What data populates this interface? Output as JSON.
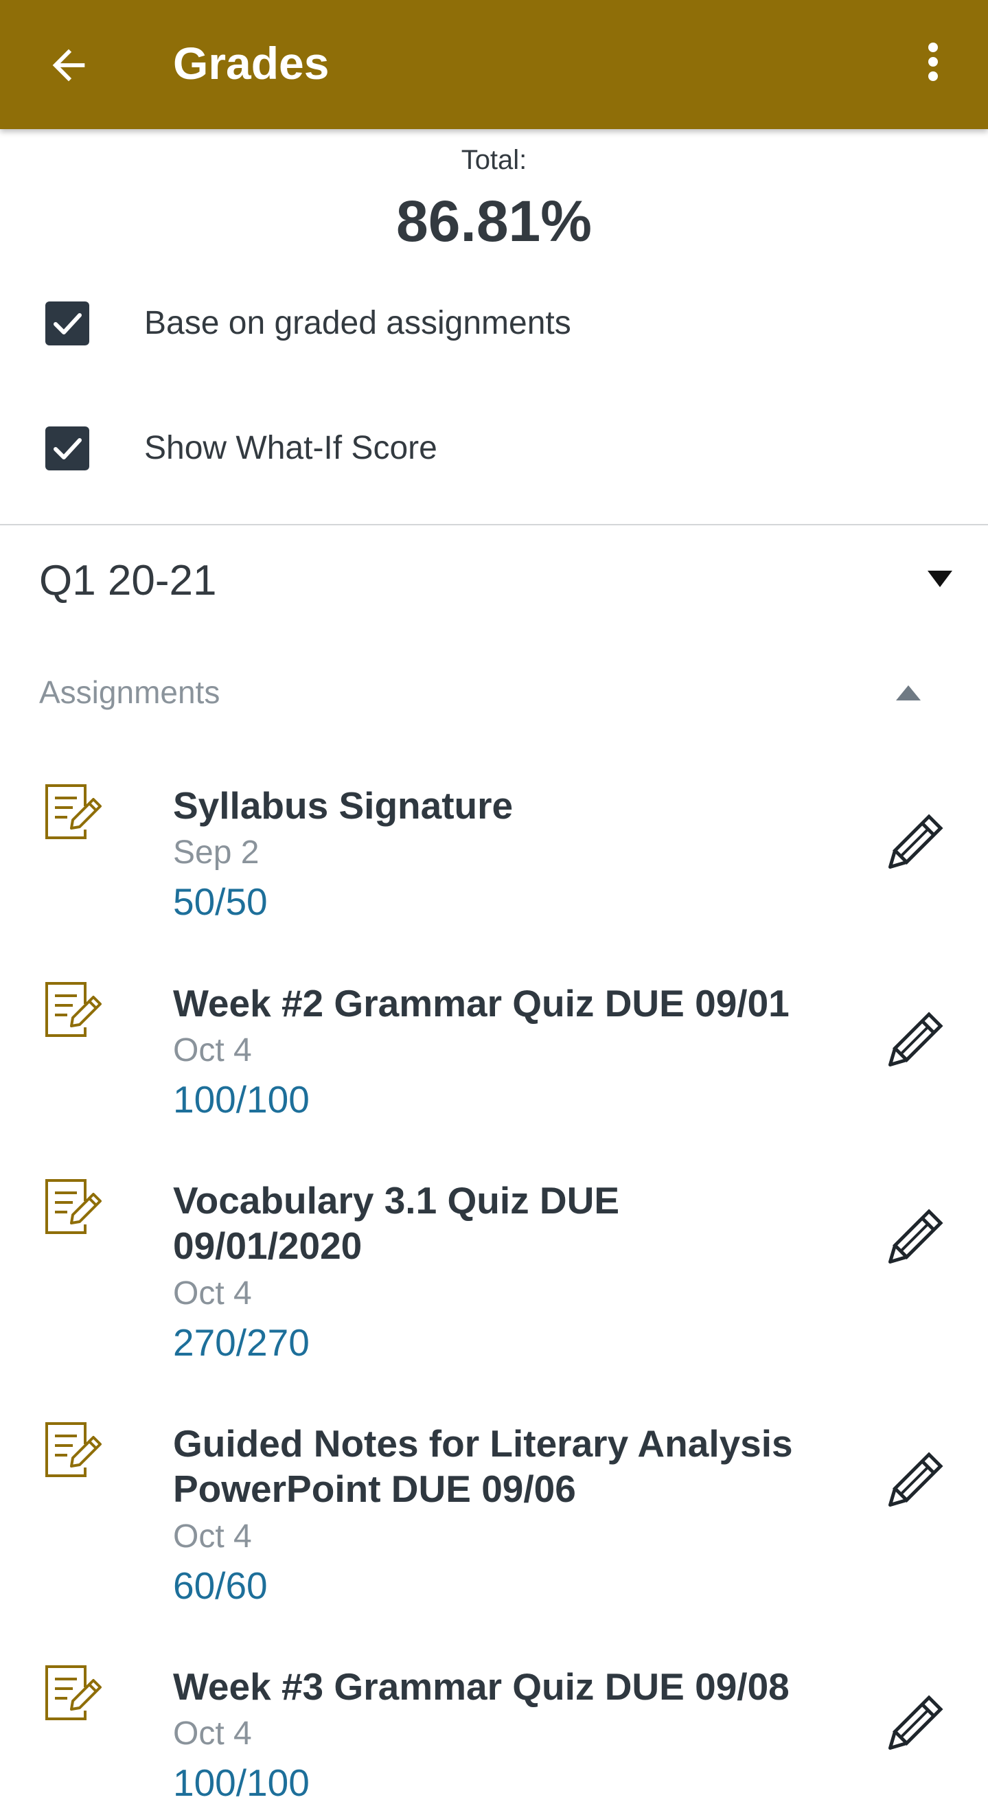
{
  "app_bar": {
    "title": "Grades",
    "back_icon": "arrow-back-icon",
    "menu_icon": "more-vert-icon",
    "color": "#8f6e08"
  },
  "summary": {
    "total_label": "Total:",
    "total_value": "86.81%"
  },
  "options": [
    {
      "label": "Base on graded assignments",
      "checked": true
    },
    {
      "label": "Show What-If Score",
      "checked": true
    }
  ],
  "term": {
    "selected": "Q1 20-21",
    "icon": "dropdown-caret-icon"
  },
  "assignments": {
    "section_title": "Assignments",
    "expanded": true,
    "items": [
      {
        "title": "Syllabus Signature",
        "date": "Sep 2",
        "score": "50/50"
      },
      {
        "title": "Week #2 Grammar Quiz DUE 09/01",
        "date": "Oct 4",
        "score": "100/100"
      },
      {
        "title": "Vocabulary 3.1 Quiz DUE 09/01/2020",
        "date": "Oct 4",
        "score": "270/270"
      },
      {
        "title": "Guided Notes for Literary Analysis PowerPoint DUE 09/06",
        "date": "Oct 4",
        "score": "60/60"
      },
      {
        "title": "Week #3 Grammar Quiz DUE 09/08",
        "date": "Oct 4",
        "score": "100/100"
      }
    ]
  },
  "colors": {
    "accent": "#8f6e08",
    "score": "#1d6f9a",
    "muted": "#8a939b",
    "text": "#333a40",
    "checkbox": "#2d3843"
  }
}
